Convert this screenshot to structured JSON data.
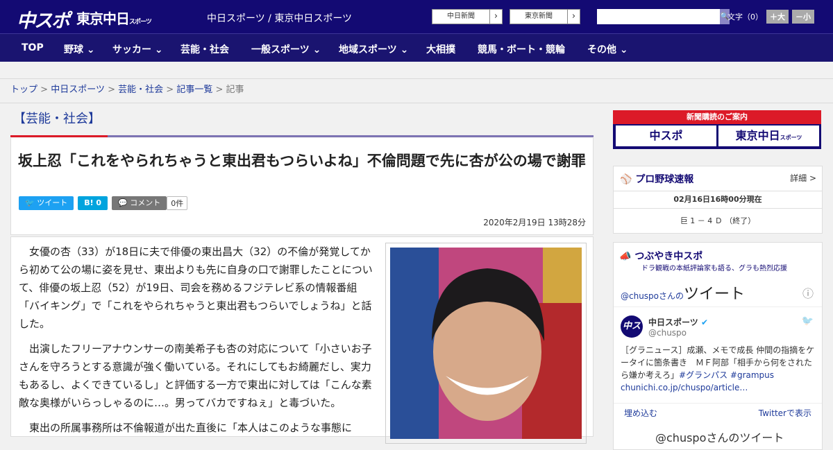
{
  "header": {
    "logo_main": "中スポ",
    "logo_sub": "東京中日",
    "logo_sub_small": "スポーツ",
    "site_name": "中日スポーツ / 東京中日スポーツ",
    "btn_chunichi": "中日新聞",
    "btn_tokyo": "東京新聞",
    "chevron": "›",
    "search_icon": "🔍",
    "font_label": "文字（0）",
    "font_up": "＋大",
    "font_down": "－小"
  },
  "nav": {
    "items": [
      "TOP",
      "野球",
      "サッカー",
      "芸能・社会",
      "一般スポーツ",
      "地域スポーツ",
      "大相撲",
      "競馬・ボート・競輪",
      "その他"
    ],
    "dropdown_icon": "⌄"
  },
  "breadcrumb": {
    "items": [
      "トップ",
      "中日スポーツ",
      "芸能・社会",
      "記事一覧"
    ],
    "current": "記事",
    "sep": ">"
  },
  "article": {
    "category": "【芸能・社会】",
    "title": "坂上忍「これをやられちゃうと東出君もつらいよね」不倫問題で先に杏が公の場で謝罪",
    "tweet": "ツイート",
    "hatena": "B! 0",
    "comment": "コメント",
    "comment_count": "0件",
    "date": "2020年2月19日 13時28分",
    "paragraphs": [
      "女優の杏（33）が18日に夫で俳優の東出昌大（32）の不倫が発覚してから初めて公の場に姿を見せ、東出よりも先に自身の口で謝罪したことについて、俳優の坂上忍（52）が19日、司会を務めるフジテレビ系の情報番組「バイキング」で「これをやられちゃうと東出君もつらいでしょうね」と話した。",
      "出演したフリーアナウンサーの南美希子も杏の対応について「小さいお子さんを守ろうとする意識が強く働いている。それにしてもお綺麗だし、実力もあるし、よくできているし」と評価する一方で東出に対しては「こんな素敵な奥様がいらっしゃるのに…。男ってバカですねぇ」と毒づいた。",
      "東出の所属事務所は不倫報道が出た直後に「本人はこのような事態に"
    ]
  },
  "sidebar": {
    "ad_title": "新聞購読のご案内",
    "ad_left": "中スポ",
    "ad_right": "東京中日",
    "ad_right_small": "スポーツ",
    "baseball_title": "プロ野球速報",
    "baseball_more": "詳細 >",
    "baseball_time": "02月16日16時00分現在",
    "baseball_score": "巨 1 － 4 Ｄ （終了）",
    "tw_title": "つぶやき中スポ",
    "tw_sub": "ドラ観戦の本紙評論家も語る、グラも熱烈応援",
    "tw_handle_prefix": "@chuspoさんの",
    "tw_heading": "ツイート",
    "tw_name": "中日スポーツ",
    "tw_handle": "@chuspo",
    "tw_text": "［グラニュース］成瀬、メモで成長 仲間の指摘をケータイに箇条書き　ＭＦ阿部「相手から何をされたら嫌か考えろ」",
    "tw_tag1": "#グランパス",
    "tw_tag2": "#grampus",
    "tw_link": "chunichi.co.jp/chuspo/article…",
    "tw_embed": "埋め込む",
    "tw_view": "Twitterで表示",
    "tw_bottom": "@chuspoさんのツイート",
    "info_icon": "ⓘ",
    "bird_icon": "🐦",
    "verified_icon": "✔",
    "avatar_text": "中スポ"
  }
}
